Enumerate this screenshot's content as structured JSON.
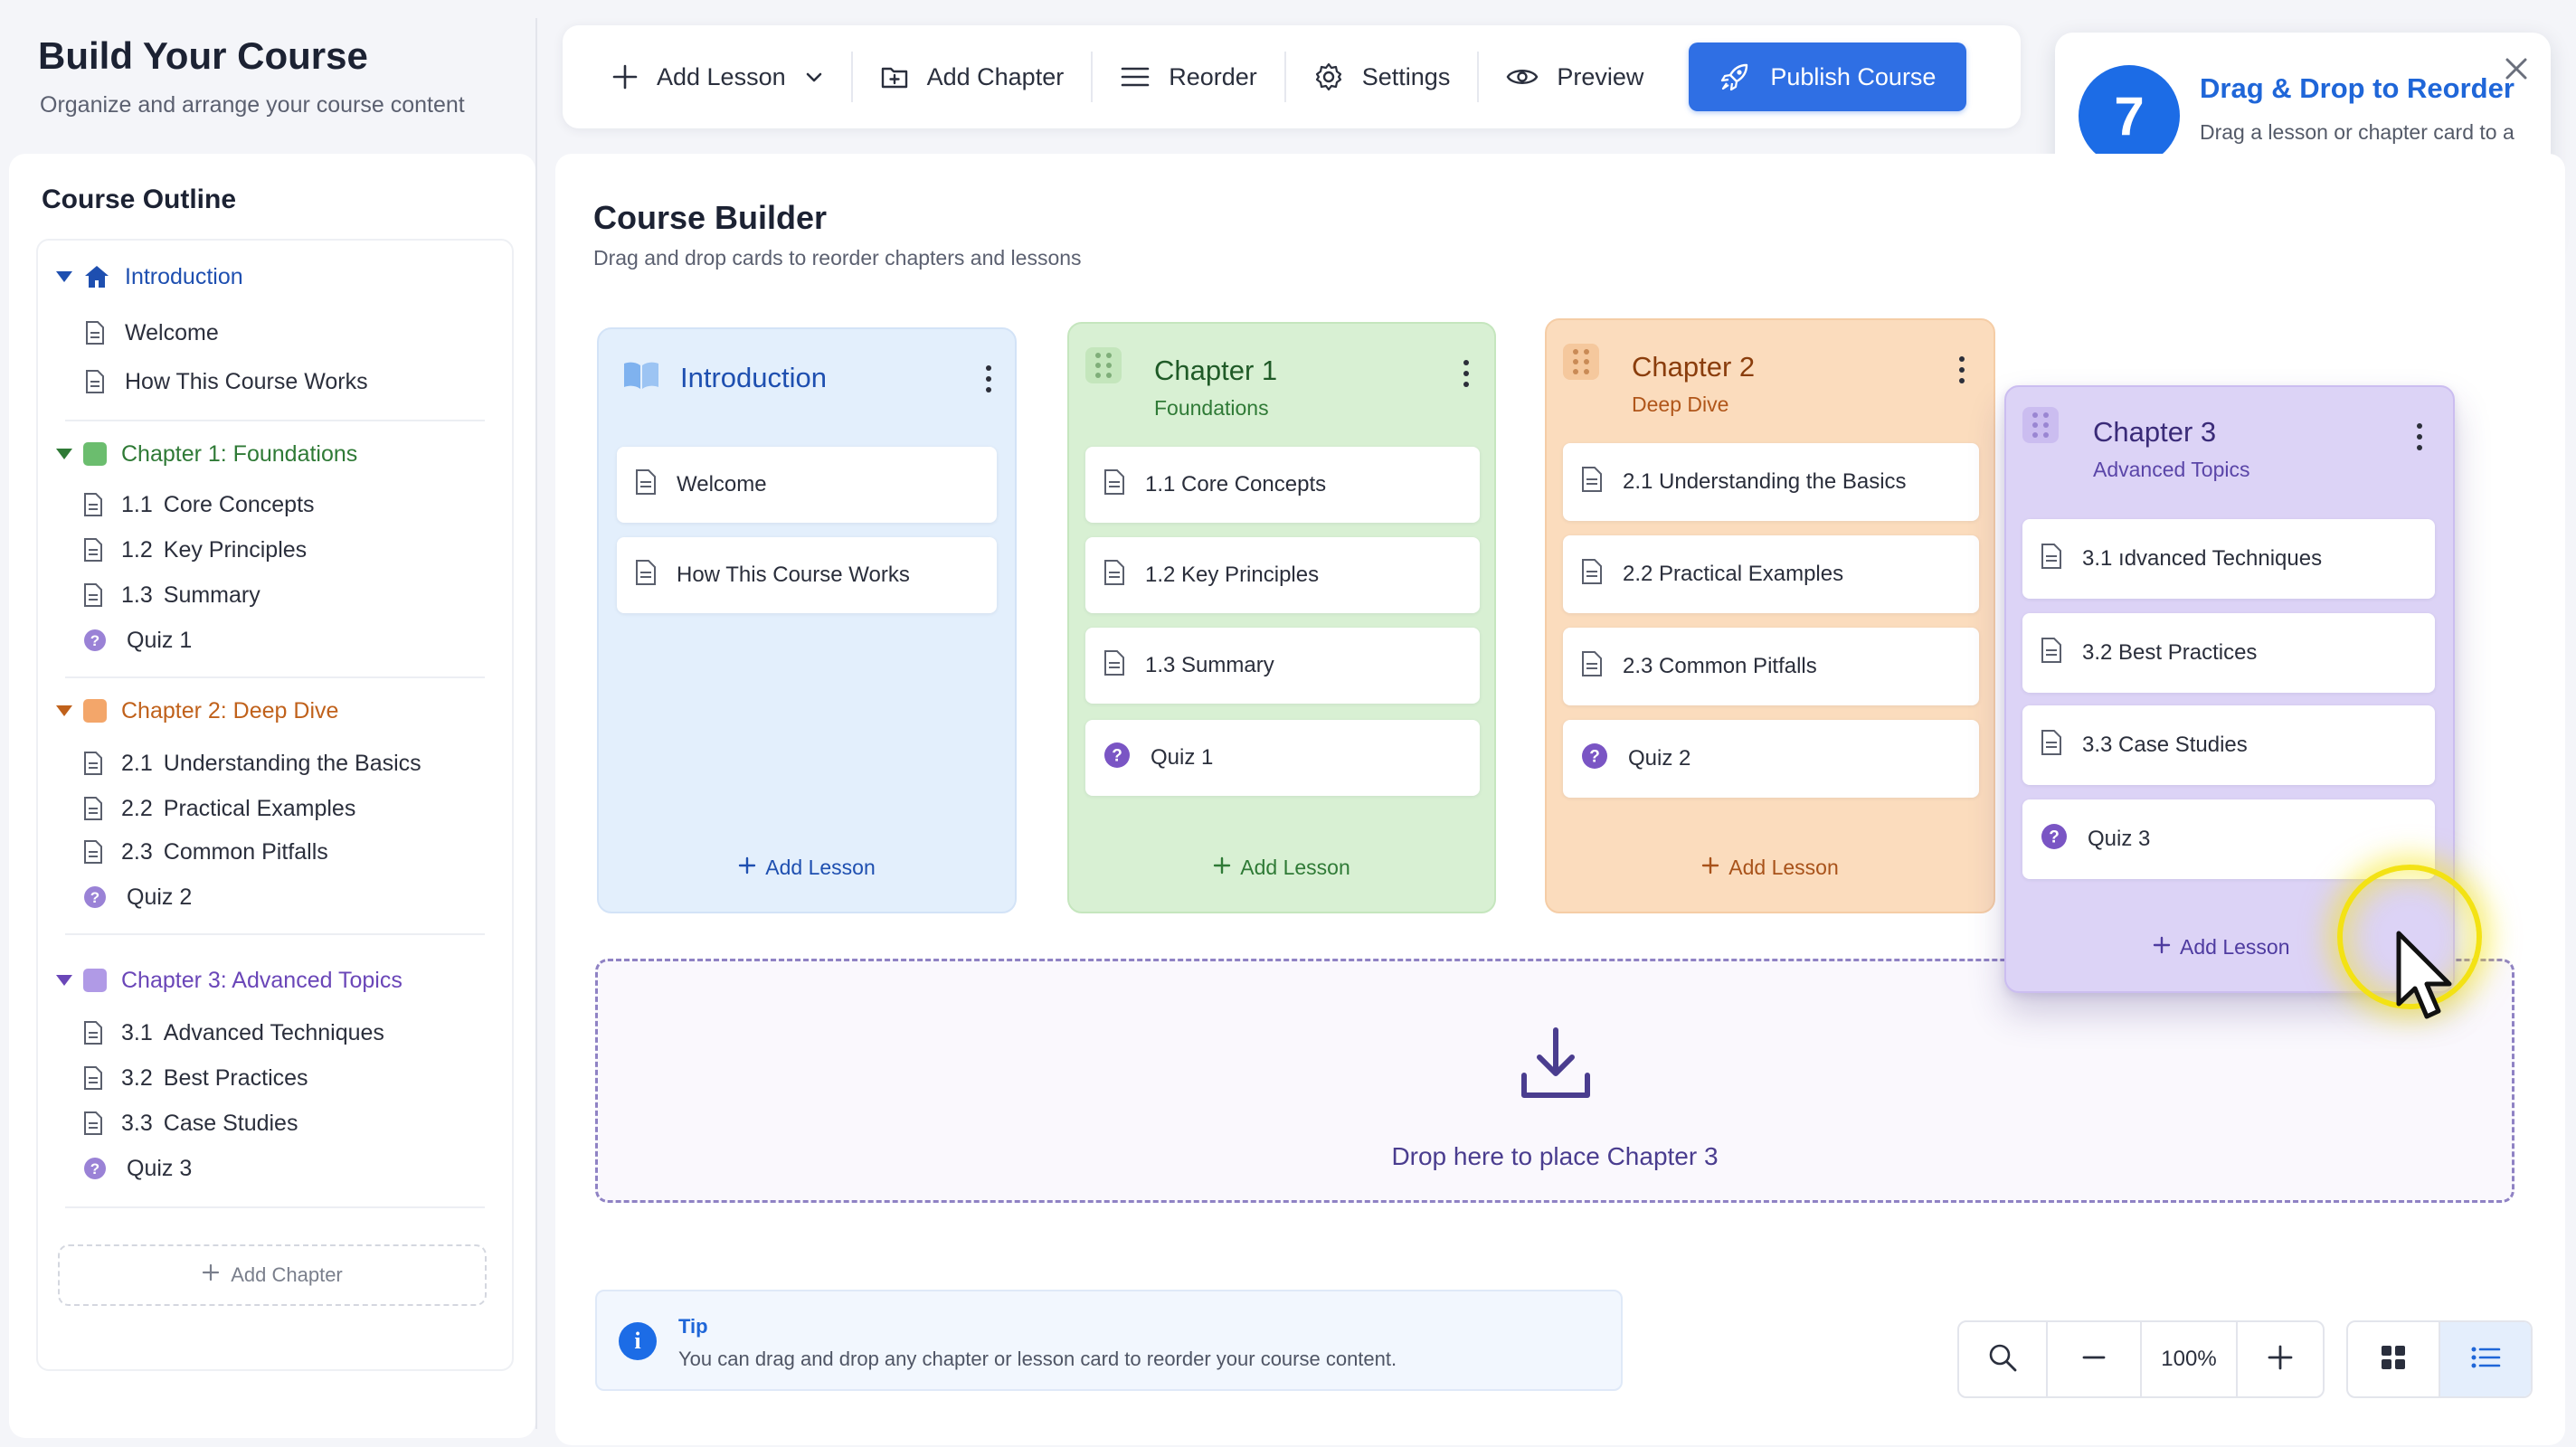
{
  "app": {
    "title": "Build Your Course",
    "subtitle": "Organize and arrange your course content"
  },
  "toolbar": {
    "add_lesson": "Add Lesson",
    "add_chapter": "Add Chapter",
    "reorder": "Reorder",
    "settings": "Settings",
    "preview": "Preview",
    "publish": "Publish Course",
    "publish_color": "#2f6fe4"
  },
  "tour": {
    "step": "7",
    "title": "Drag & Drop to Reorder",
    "body": "Drag a lesson or chapter card to a new position. Release to drop it into place."
  },
  "sidebar": {
    "heading": "Course Outline",
    "groups": [
      {
        "title": "Introduction",
        "color": "#1e4fb0",
        "icon": "home-icon",
        "items": [
          {
            "label": "Welcome",
            "icon": "document-icon"
          },
          {
            "label": "How This Course Works",
            "icon": "document-icon"
          }
        ]
      },
      {
        "title": "Chapter 1: Foundations",
        "color": "#2f7a36",
        "icon": "green-square-icon",
        "items": [
          {
            "num": "1.1",
            "label": "Core Concepts",
            "icon": "document-icon"
          },
          {
            "num": "1.2",
            "label": "Key Principles",
            "icon": "document-icon"
          },
          {
            "num": "1.3",
            "label": "Summary",
            "icon": "document-icon"
          },
          {
            "num": "",
            "label": "Quiz 1",
            "icon": "quiz-icon"
          }
        ]
      },
      {
        "title": "Chapter 2: Deep Dive",
        "color": "#c0611b",
        "icon": "orange-square-icon",
        "items": [
          {
            "num": "2.1",
            "label": "Understanding the Basics",
            "icon": "document-icon"
          },
          {
            "num": "2.2",
            "label": "Practical Examples",
            "icon": "document-icon"
          },
          {
            "num": "2.3",
            "label": "Common Pitfalls",
            "icon": "document-icon"
          },
          {
            "num": "",
            "label": "Quiz 2",
            "icon": "quiz-icon"
          }
        ]
      },
      {
        "title": "Chapter 3: Advanced Topics",
        "color": "#6a46b8",
        "icon": "purple-square-icon",
        "items": [
          {
            "num": "3.1",
            "label": "Advanced Techniques",
            "icon": "document-icon"
          },
          {
            "num": "3.2",
            "label": "Best Practices",
            "icon": "document-icon"
          },
          {
            "num": "3.3",
            "label": "Case Studies",
            "icon": "document-icon"
          },
          {
            "num": "",
            "label": "Quiz 3",
            "icon": "quiz-icon"
          }
        ]
      }
    ],
    "add_chapter": "Add Chapter"
  },
  "builder": {
    "title": "Course Builder",
    "subtitle": "Drag and drop cards to reorder chapters and lessons",
    "columns": [
      {
        "title": "Introduction",
        "subtitle": "",
        "cards": [
          "Welcome",
          "How This Course Works"
        ],
        "add": "Add Lesson"
      },
      {
        "title": "Chapter 1",
        "subtitle": "Foundations",
        "cards": [
          "1.1 Core Concepts",
          "1.2 Key Principles",
          "1.3 Summary",
          "Quiz 1"
        ],
        "add": "Add Lesson"
      },
      {
        "title": "Chapter 2",
        "subtitle": "Deep Dive",
        "cards": [
          "2.1 Understanding the Basics",
          "2.2 Practical Examples",
          "2.3 Common Pitfalls",
          "Quiz 2"
        ],
        "add": "Add Lesson"
      }
    ],
    "dragging": {
      "title": "Chapter 3",
      "subtitle": "Advanced Topics",
      "cards": [
        "3.1 ıdvanced Techniques",
        "3.2 Best Practices",
        "3.3 Case Studies",
        "Quiz 3"
      ],
      "add": "Add Lesson"
    },
    "drop_label": "Drop here to place Chapter 3",
    "tip_title": "Tip",
    "tip_body": "You can drag and drop any chapter or lesson card to reorder your course content.",
    "zoom": "100%"
  },
  "colors": {
    "intro_bg": "#e3effc",
    "chapter1_bg": "#d8f0d3",
    "chapter2_bg": "#fbdcbd",
    "chapter3_bg": "#dcd3f6",
    "accent": "#1c6ce6"
  }
}
